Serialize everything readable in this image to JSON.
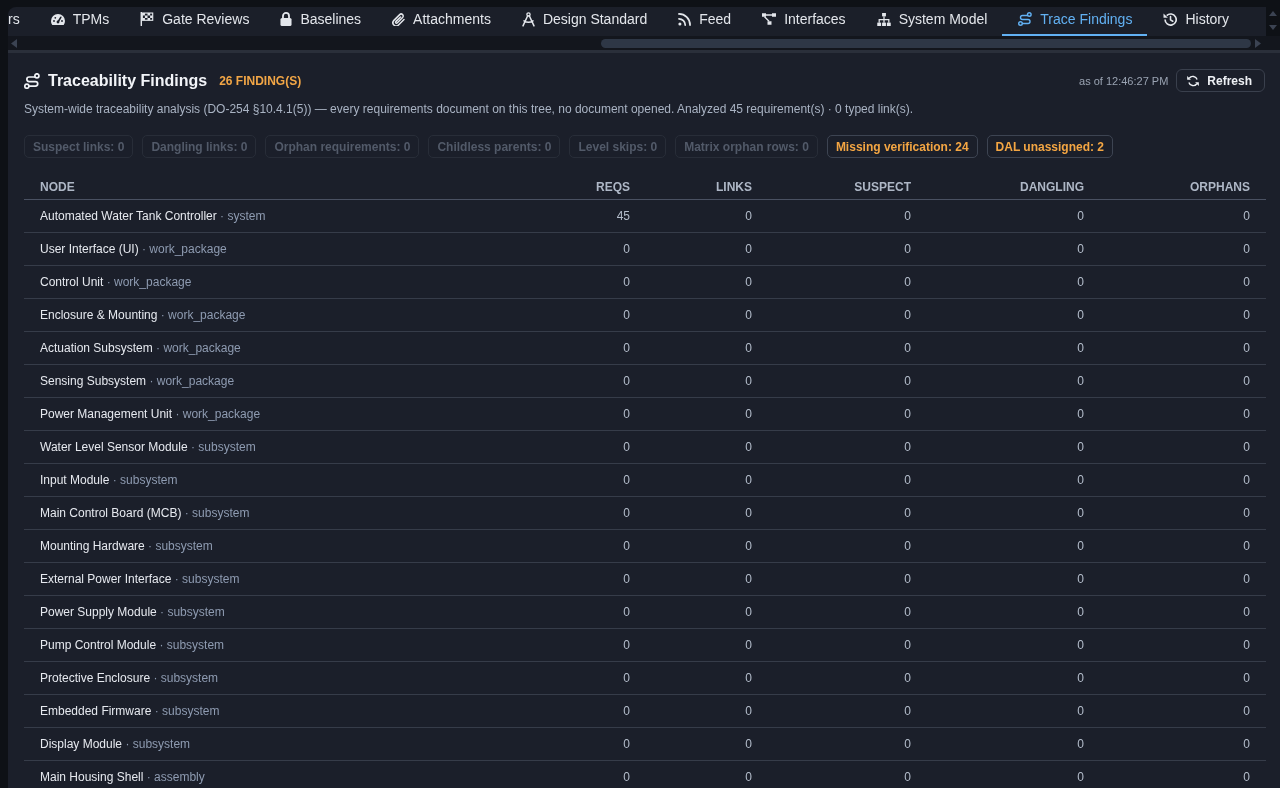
{
  "tabs": [
    {
      "label": "rs",
      "selected": false
    },
    {
      "label": "TPMs",
      "selected": false
    },
    {
      "label": "Gate Reviews",
      "selected": false
    },
    {
      "label": "Baselines",
      "selected": false
    },
    {
      "label": "Attachments",
      "selected": false
    },
    {
      "label": "Design Standard",
      "selected": false
    },
    {
      "label": "Feed",
      "selected": false
    },
    {
      "label": "Interfaces",
      "selected": false
    },
    {
      "label": "System Model",
      "selected": false
    },
    {
      "label": "Trace Findings",
      "selected": true
    },
    {
      "label": "History",
      "selected": false
    }
  ],
  "header": {
    "title": "Traceability Findings",
    "badge": "26 FINDING(S)",
    "timestamp": "as of 12:46:27 PM",
    "refresh_button": "Refresh"
  },
  "description": "System-wide traceability analysis (DO-254 §10.4.1(5)) — every requirements document on this tree, no document opened. Analyzed 45 requirement(s) · 0 typed link(s).",
  "chips": [
    {
      "label": "Suspect links: 0",
      "flagged": false
    },
    {
      "label": "Dangling links: 0",
      "flagged": false
    },
    {
      "label": "Orphan requirements: 0",
      "flagged": false
    },
    {
      "label": "Childless parents: 0",
      "flagged": false
    },
    {
      "label": "Level skips: 0",
      "flagged": false
    },
    {
      "label": "Matrix orphan rows: 0",
      "flagged": false
    },
    {
      "label": "Missing verification: 24",
      "flagged": true
    },
    {
      "label": "DAL unassigned: 2",
      "flagged": true
    }
  ],
  "table": {
    "columns": [
      "NODE",
      "REQS",
      "LINKS",
      "SUSPECT",
      "DANGLING",
      "ORPHANS"
    ],
    "rows": [
      {
        "node": "Automated Water Tank Controller",
        "category": "· system",
        "reqs": "45",
        "links": "0",
        "suspect": "0",
        "dangling": "0",
        "orphans": "0"
      },
      {
        "node": "User Interface (UI)",
        "category": "· work_package",
        "reqs": "0",
        "links": "0",
        "suspect": "0",
        "dangling": "0",
        "orphans": "0"
      },
      {
        "node": "Control Unit",
        "category": "· work_package",
        "reqs": "0",
        "links": "0",
        "suspect": "0",
        "dangling": "0",
        "orphans": "0"
      },
      {
        "node": "Enclosure & Mounting",
        "category": "· work_package",
        "reqs": "0",
        "links": "0",
        "suspect": "0",
        "dangling": "0",
        "orphans": "0"
      },
      {
        "node": "Actuation Subsystem",
        "category": "· work_package",
        "reqs": "0",
        "links": "0",
        "suspect": "0",
        "dangling": "0",
        "orphans": "0"
      },
      {
        "node": "Sensing Subsystem",
        "category": "· work_package",
        "reqs": "0",
        "links": "0",
        "suspect": "0",
        "dangling": "0",
        "orphans": "0"
      },
      {
        "node": "Power Management Unit",
        "category": "· work_package",
        "reqs": "0",
        "links": "0",
        "suspect": "0",
        "dangling": "0",
        "orphans": "0"
      },
      {
        "node": "Water Level Sensor Module",
        "category": "· subsystem",
        "reqs": "0",
        "links": "0",
        "suspect": "0",
        "dangling": "0",
        "orphans": "0"
      },
      {
        "node": "Input Module",
        "category": "· subsystem",
        "reqs": "0",
        "links": "0",
        "suspect": "0",
        "dangling": "0",
        "orphans": "0"
      },
      {
        "node": "Main Control Board (MCB)",
        "category": "· subsystem",
        "reqs": "0",
        "links": "0",
        "suspect": "0",
        "dangling": "0",
        "orphans": "0"
      },
      {
        "node": "Mounting Hardware",
        "category": "· subsystem",
        "reqs": "0",
        "links": "0",
        "suspect": "0",
        "dangling": "0",
        "orphans": "0"
      },
      {
        "node": "External Power Interface",
        "category": "· subsystem",
        "reqs": "0",
        "links": "0",
        "suspect": "0",
        "dangling": "0",
        "orphans": "0"
      },
      {
        "node": "Power Supply Module",
        "category": "· subsystem",
        "reqs": "0",
        "links": "0",
        "suspect": "0",
        "dangling": "0",
        "orphans": "0"
      },
      {
        "node": "Pump Control Module",
        "category": "· subsystem",
        "reqs": "0",
        "links": "0",
        "suspect": "0",
        "dangling": "0",
        "orphans": "0"
      },
      {
        "node": "Protective Enclosure",
        "category": "· subsystem",
        "reqs": "0",
        "links": "0",
        "suspect": "0",
        "dangling": "0",
        "orphans": "0"
      },
      {
        "node": "Embedded Firmware",
        "category": "· subsystem",
        "reqs": "0",
        "links": "0",
        "suspect": "0",
        "dangling": "0",
        "orphans": "0"
      },
      {
        "node": "Display Module",
        "category": "· subsystem",
        "reqs": "0",
        "links": "0",
        "suspect": "0",
        "dangling": "0",
        "orphans": "0"
      },
      {
        "node": "Main Housing Shell",
        "category": "· assembly",
        "reqs": "0",
        "links": "0",
        "suspect": "0",
        "dangling": "0",
        "orphans": "0"
      }
    ]
  }
}
